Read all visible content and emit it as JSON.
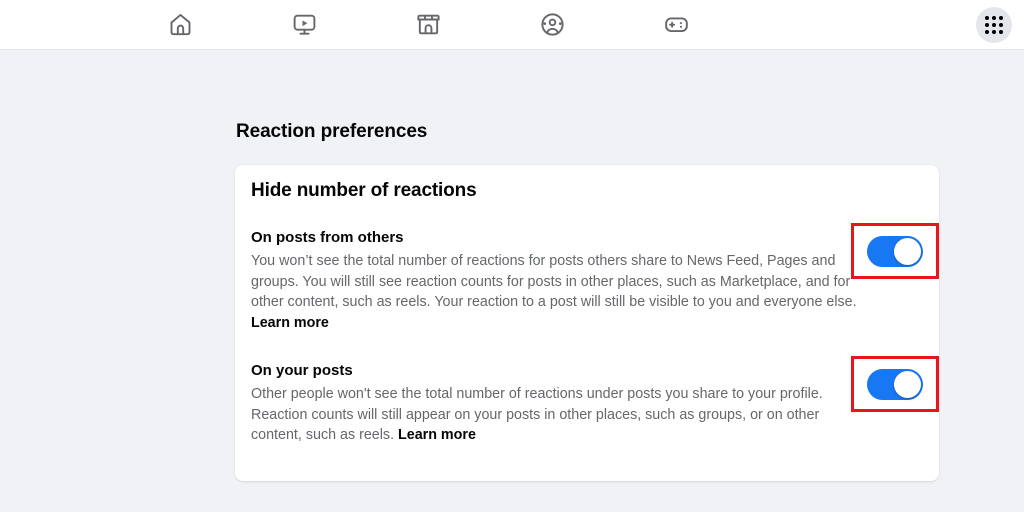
{
  "topbar": {
    "icons": [
      {
        "name": "home-icon",
        "label": "Home"
      },
      {
        "name": "video-icon",
        "label": "Video"
      },
      {
        "name": "marketplace-icon",
        "label": "Marketplace"
      },
      {
        "name": "groups-icon",
        "label": "Groups"
      },
      {
        "name": "gaming-icon",
        "label": "Gaming"
      }
    ],
    "menu_button": {
      "name": "grid-menu-icon",
      "label": "Menu"
    }
  },
  "page": {
    "title": "Reaction preferences"
  },
  "card": {
    "title": "Hide number of reactions",
    "settings": [
      {
        "label": "On posts from others",
        "description": "You won’t see the total number of reactions for posts others share to News Feed, Pages and groups. You will still see reaction counts for posts in other places, such as Marketplace, and for other content, such as reels. Your reaction to a post will still be visible to you and everyone else. ",
        "link_label": "Learn more",
        "toggle_state": "on"
      },
      {
        "label": "On your posts",
        "description": "Other people won't see the total number of reactions under posts you share to your profile. Reaction counts will still appear on your posts in other places, such as groups, or on other content, such as reels. ",
        "link_label": "Learn more",
        "toggle_state": "on"
      }
    ]
  },
  "colors": {
    "accent": "#1877f2",
    "highlight": "#e8161a",
    "background": "#f0f2f5",
    "card": "#ffffff",
    "text_primary": "#050505",
    "text_secondary": "#65676b"
  }
}
